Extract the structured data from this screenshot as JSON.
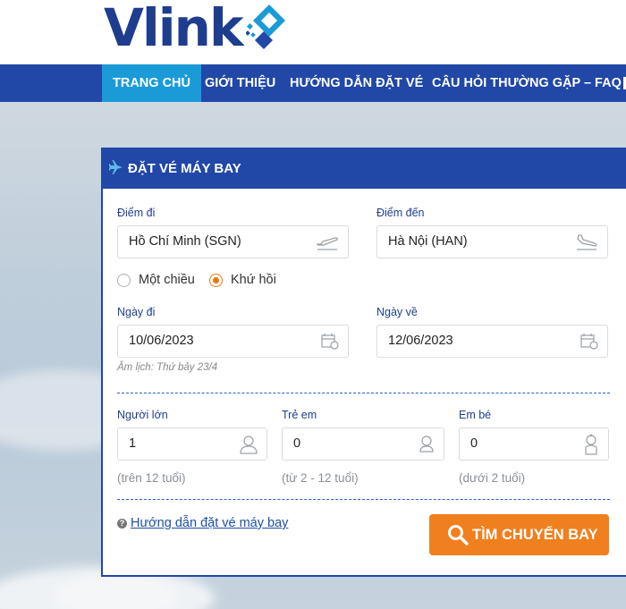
{
  "brand": {
    "logo_text": "Vlink"
  },
  "nav": {
    "items": [
      {
        "label": "TRANG CHỦ",
        "active": true
      },
      {
        "label": "GIỚI THIỆU"
      },
      {
        "label": "HƯỚNG DẪN ĐẶT VÉ"
      },
      {
        "label": "CÂU HỎI THƯỜNG GẶP – FAQ"
      }
    ]
  },
  "booking": {
    "title": "ĐẶT VÉ MÁY BAY",
    "header_icon": "airplane-icon",
    "from": {
      "label": "Điểm đi",
      "value": "Hồ Chí Minh (SGN)",
      "icon": "plane-takeoff-icon"
    },
    "to": {
      "label": "Điểm đến",
      "value": "Hà Nội (HAN)",
      "icon": "plane-landing-icon"
    },
    "trip_type": {
      "options": [
        {
          "label": "Một chiều",
          "selected": false
        },
        {
          "label": "Khứ hồi",
          "selected": true
        }
      ]
    },
    "depart": {
      "label": "Ngày đi",
      "value": "10/06/2023",
      "icon": "calendar-icon"
    },
    "return": {
      "label": "Ngày về",
      "value": "12/06/2023",
      "icon": "calendar-icon"
    },
    "lunar_note": "Âm lịch: Thứ bảy 23/4",
    "passengers": {
      "adults": {
        "label": "Người lớn",
        "value": "1",
        "hint": "(trên 12 tuổi)",
        "icon": "adult-icon"
      },
      "children": {
        "label": "Trẻ em",
        "value": "0",
        "hint": "(từ 2 - 12 tuổi)",
        "icon": "child-icon"
      },
      "infants": {
        "label": "Em bé",
        "value": "0",
        "hint": "(dưới 2 tuổi)",
        "icon": "baby-icon"
      }
    },
    "guide_link": "Hướng dẫn đặt vé máy bay",
    "search_button": "TÌM CHUYẾN BAY"
  },
  "colors": {
    "brand_blue": "#2147a7",
    "active_tab": "#1a9bd7",
    "accent_orange": "#f07f1e"
  }
}
